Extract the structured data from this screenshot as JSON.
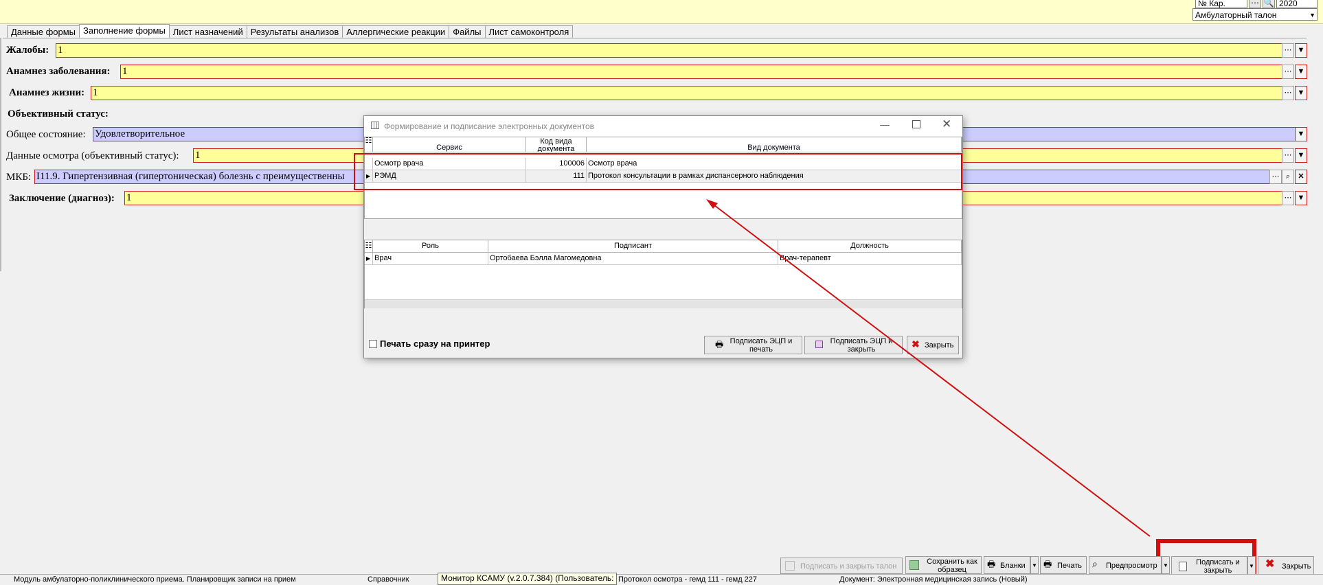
{
  "top": {
    "right_field_top": "№ Кар.",
    "right_field_year": "2020",
    "dropdown_value": "Амбулаторный талон"
  },
  "tabs": [
    {
      "label": "Данные формы"
    },
    {
      "label": "Заполнение формы"
    },
    {
      "label": "Лист назначений"
    },
    {
      "label": "Результаты анализов"
    },
    {
      "label": "Аллергические реакции"
    },
    {
      "label": "Файлы"
    },
    {
      "label": "Лист самоконтроля"
    }
  ],
  "form": {
    "complaints": {
      "label": "Жалобы:",
      "value": "1"
    },
    "anamnesis_disease": {
      "label": "Анамнез заболевания:",
      "value": "1"
    },
    "anamnesis_life": {
      "label": "Анамнез жизни:",
      "value": "1"
    },
    "objective_status_heading": "Объективный статус:",
    "general_state": {
      "label": "Общее состояние:",
      "value": "Удовлетворительное"
    },
    "exam_data": {
      "label": "Данные осмотра (объективный статус):",
      "value": "1"
    },
    "mkb": {
      "label": "МКБ:",
      "value": "I11.9. Гипертензивная (гипертоническая) болезнь с преимущественны"
    },
    "conclusion": {
      "label": "Заключение (диагноз):",
      "value": "1"
    }
  },
  "dialog": {
    "title": "Формирование и подписание электронных документов",
    "docs_headers": {
      "service": "Сервис",
      "code": "Код вида документа",
      "kind": "Вид документа"
    },
    "docs_rows": [
      {
        "service": "Осмотр врача",
        "code": "100006",
        "kind": "Осмотр врача"
      },
      {
        "service": "РЭМД",
        "code": "111",
        "kind": "Протокол консультации в рамках диспансерного наблюдения"
      }
    ],
    "signers_headers": {
      "role": "Роль",
      "signer": "Подписант",
      "position": "Должность"
    },
    "signers_rows": [
      {
        "role": "Врач",
        "signer": "Ортобаева Бэлла Магомедовна",
        "position": "Врач-терапевт"
      }
    ],
    "print_checkbox_label": "Печать сразу на принтер",
    "sign_print_label": "Подписать ЭЦП и печать",
    "sign_close_label": "Подписать ЭЦП и закрыть",
    "close_label": "Закрыть"
  },
  "bottom_toolbar": {
    "sign_close_ticket": "Подписать и закрыть талон",
    "save_as_template": "Сохранить как образец",
    "forms": "Бланки",
    "print": "Печать",
    "preview": "Предпросмотр",
    "sign_and_close": "Подписать и закрыть",
    "close": "Закрыть"
  },
  "statusbar": {
    "item1": "Модуль амбулаторно-поликлинического приема. Планировщик записи на прием",
    "item2": "Справочник",
    "tooltip": "Монитор КСАМУ (v.2.0.7.384) (Пользователь:",
    "item3": "Протокол осмотра - гемд 111 - гемд 227",
    "item4": "Документ: Электронная медицинская запись (Новый)"
  },
  "colors": {
    "field_yellow": "#ffff99",
    "field_lavender": "#ccccff",
    "highlight_red": "#d01010"
  }
}
